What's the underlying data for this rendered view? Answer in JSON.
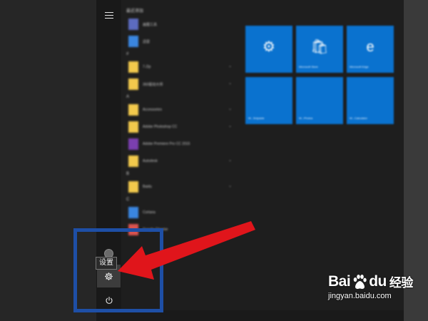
{
  "start_menu": {
    "tooltip": "设置",
    "app_list": [
      {
        "type": "header",
        "text": "最近添加"
      },
      {
        "type": "app",
        "name": "画图工具",
        "tile_color": "#5c6bc0",
        "chevron": false
      },
      {
        "type": "app",
        "name": "迅雷",
        "tile_color": "#3a86e0",
        "chevron": false
      },
      {
        "type": "header",
        "text": "#"
      },
      {
        "type": "app",
        "name": "7-Zip",
        "tile_color": "#f2c94c",
        "chevron": true
      },
      {
        "type": "app",
        "name": "360驱动大师",
        "tile_color": "#f2c94c",
        "chevron": true
      },
      {
        "type": "header",
        "text": "A"
      },
      {
        "type": "app",
        "name": "Accessories",
        "tile_color": "#f2c94c",
        "chevron": true
      },
      {
        "type": "app",
        "name": "Adobe Photoshop CC",
        "tile_color": "#f2c94c",
        "chevron": true
      },
      {
        "type": "app",
        "name": "Adobe Premiere Pro CC 2015",
        "tile_color": "#7b3fb0",
        "chevron": false
      },
      {
        "type": "app",
        "name": "Autodesk",
        "tile_color": "#f2c94c",
        "chevron": true
      },
      {
        "type": "header",
        "text": "B"
      },
      {
        "type": "app",
        "name": "Baidu",
        "tile_color": "#f2c94c",
        "chevron": true
      },
      {
        "type": "header",
        "text": "C"
      },
      {
        "type": "app",
        "name": "Cortana",
        "tile_color": "#3a86e0",
        "chevron": false
      },
      {
        "type": "app",
        "name": "Google Chrome",
        "tile_color": "#d9534f",
        "chevron": false
      }
    ],
    "tiles": [
      {
        "glyph": "⚙",
        "label": "",
        "icon": "settings-icon"
      },
      {
        "glyph": "🛍",
        "label": "Microsoft Store",
        "icon": "store-icon"
      },
      {
        "glyph": "e",
        "label": "Microsoft Edge",
        "icon": "edge-icon"
      },
      {
        "glyph": "",
        "label": "W...Snipaste",
        "icon": "app-icon"
      },
      {
        "glyph": "",
        "label": "W...Photos",
        "icon": "photos-icon"
      },
      {
        "glyph": "",
        "label": "W...Calculator",
        "icon": "calculator-icon"
      }
    ],
    "tile_color": "#0a72cf"
  },
  "annotation": {
    "box_color": "#1e4fa6",
    "arrow_color": "#e0151b"
  },
  "watermark": {
    "brand_left": "Bai",
    "brand_right": "du",
    "brand_cn": "经验",
    "url": "jingyan.baidu.com"
  }
}
